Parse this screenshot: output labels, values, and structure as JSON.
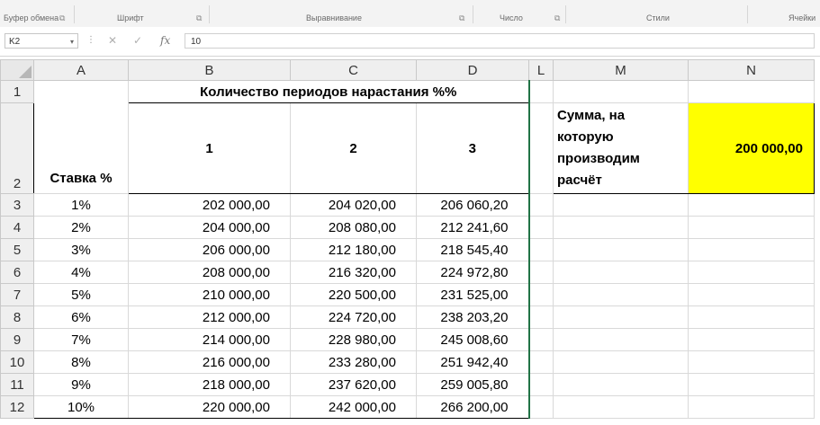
{
  "ribbon": {
    "groups": [
      "Буфер обмена",
      "Шрифт",
      "Выравнивание",
      "Число",
      "Стили",
      "Ячейки"
    ],
    "launcher": "⧉"
  },
  "formula_bar": {
    "name_box": "K2",
    "cancel": "✕",
    "enter": "✓",
    "fx": "fx",
    "value": "10"
  },
  "columns": [
    "A",
    "B",
    "C",
    "D",
    "L",
    "M",
    "N"
  ],
  "rows": [
    "1",
    "2",
    "3",
    "4",
    "5",
    "6",
    "7",
    "8",
    "9",
    "10",
    "11",
    "12"
  ],
  "sheet": {
    "title": "Количество периодов нарастания %%",
    "rate_header": "Ставка %",
    "periods": [
      "1",
      "2",
      "3"
    ],
    "data": [
      {
        "rate": "1%",
        "p1": "202 000,00",
        "p2": "204 020,00",
        "p3": "206 060,20"
      },
      {
        "rate": "2%",
        "p1": "204 000,00",
        "p2": "208 080,00",
        "p3": "212 241,60"
      },
      {
        "rate": "3%",
        "p1": "206 000,00",
        "p2": "212 180,00",
        "p3": "218 545,40"
      },
      {
        "rate": "4%",
        "p1": "208 000,00",
        "p2": "216 320,00",
        "p3": "224 972,80"
      },
      {
        "rate": "5%",
        "p1": "210 000,00",
        "p2": "220 500,00",
        "p3": "231 525,00"
      },
      {
        "rate": "6%",
        "p1": "212 000,00",
        "p2": "224 720,00",
        "p3": "238 203,20"
      },
      {
        "rate": "7%",
        "p1": "214 000,00",
        "p2": "228 980,00",
        "p3": "245 008,60"
      },
      {
        "rate": "8%",
        "p1": "216 000,00",
        "p2": "233 280,00",
        "p3": "251 942,40"
      },
      {
        "rate": "9%",
        "p1": "218 000,00",
        "p2": "237 620,00",
        "p3": "259 005,80"
      },
      {
        "rate": "10%",
        "p1": "220 000,00",
        "p2": "242 000,00",
        "p3": "266 200,00"
      }
    ],
    "sum_label": "Сумма, на которую производим расчёт",
    "sum_value": "200 000,00",
    "highlight_color": "#ffff00",
    "selection_color": "#217346"
  }
}
